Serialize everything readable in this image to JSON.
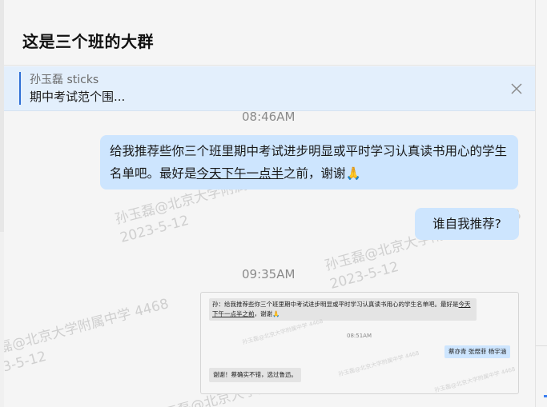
{
  "conversation": {
    "title": "这是三个班的大群"
  },
  "pinned": {
    "sender": "孙玉磊 sticks",
    "snippet": "期中考试范个围..."
  },
  "timestamps": [
    "08:46AM",
    "09:35AM"
  ],
  "messages": [
    {
      "part1": "给我推荐些你三个班里期中考试进步明显或平时学习认真读书用心的学生名单吧。最好是",
      "underlined": "今天下午一点半",
      "part2": "之前，谢谢",
      "emoji": "🙏"
    },
    {
      "text": "谁自我推荐?"
    }
  ],
  "watermarks": {
    "line1": "孙玉磊@北京大学附属中学 4468",
    "line2": "2023-5-12"
  },
  "screenshot": {
    "msg1_prefix": "孙：",
    "msg1_a": "给我推荐些你三个班里期中考试进步明显或平时学习认真读书用心的学生名单吧。最好是",
    "msg1_u": "今天下午一点半之前",
    "msg1_b": "，谢谢🙏",
    "time": "08:51AM",
    "reply": "蔡亦青 张煜菲 杨宇涵",
    "msg3": "谢谢！蔡确实不错，选过鲁迅。"
  },
  "icons": {
    "close": "close-icon"
  }
}
